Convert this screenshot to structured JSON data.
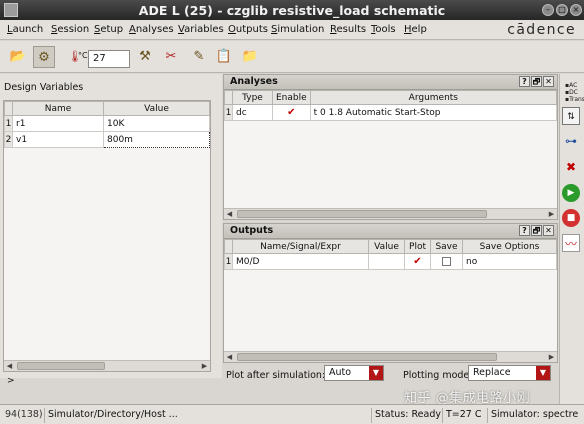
{
  "window": {
    "title": "ADE L (25) - czglib resistive_load schematic"
  },
  "brand": "cādence",
  "menu": [
    "Launch",
    "Session",
    "Setup",
    "Analyses",
    "Variables",
    "Outputs",
    "Simulation",
    "Results",
    "Tools",
    "Help"
  ],
  "toolbar": {
    "temperature_value": "27",
    "temp_label": "°C"
  },
  "design_variables": {
    "title": "Design Variables",
    "columns": [
      "Name",
      "Value"
    ],
    "rows": [
      {
        "num": "1",
        "name": "r1",
        "value": "10K"
      },
      {
        "num": "2",
        "name": "v1",
        "value": "800m"
      }
    ],
    "footer_arrow": ">"
  },
  "analyses": {
    "title": "Analyses",
    "columns": [
      "Type",
      "Enable",
      "Arguments"
    ],
    "rows": [
      {
        "num": "1",
        "type": "dc",
        "enabled": true,
        "arguments": "t 0 1.8 Automatic Start-Stop"
      }
    ]
  },
  "outputs": {
    "title": "Outputs",
    "columns": [
      "Name/Signal/Expr",
      "Value",
      "Plot",
      "Save",
      "Save Options"
    ],
    "rows": [
      {
        "num": "1",
        "name": "M0/D",
        "value": "",
        "plot": true,
        "save": false,
        "save_options": "no"
      }
    ]
  },
  "bottom_controls": {
    "plot_after_label": "Plot after simulation:",
    "plot_after_value": "Auto",
    "plotting_mode_label": "Plotting mode:",
    "plotting_mode_value": "Replace"
  },
  "panel_buttons": [
    "?",
    "🗗",
    "✕"
  ],
  "right_toolbar_icons": [
    "ac-dc-trans-icon",
    "tune-icon",
    "netlist-icon",
    "delete-icon",
    "run-icon",
    "stop-icon",
    "waveform-icon"
  ],
  "status": {
    "line": "94(138)",
    "prompt": "Simulator/Directory/Host ...",
    "state": "Status: Ready",
    "temp": "T=27 C",
    "simulator": "Simulator: spectre"
  },
  "watermark": "知乎 @集成电路小刚",
  "colors": {
    "accent_red": "#c00000",
    "run_green": "#2a9a2a",
    "stop_red": "#d33030"
  }
}
